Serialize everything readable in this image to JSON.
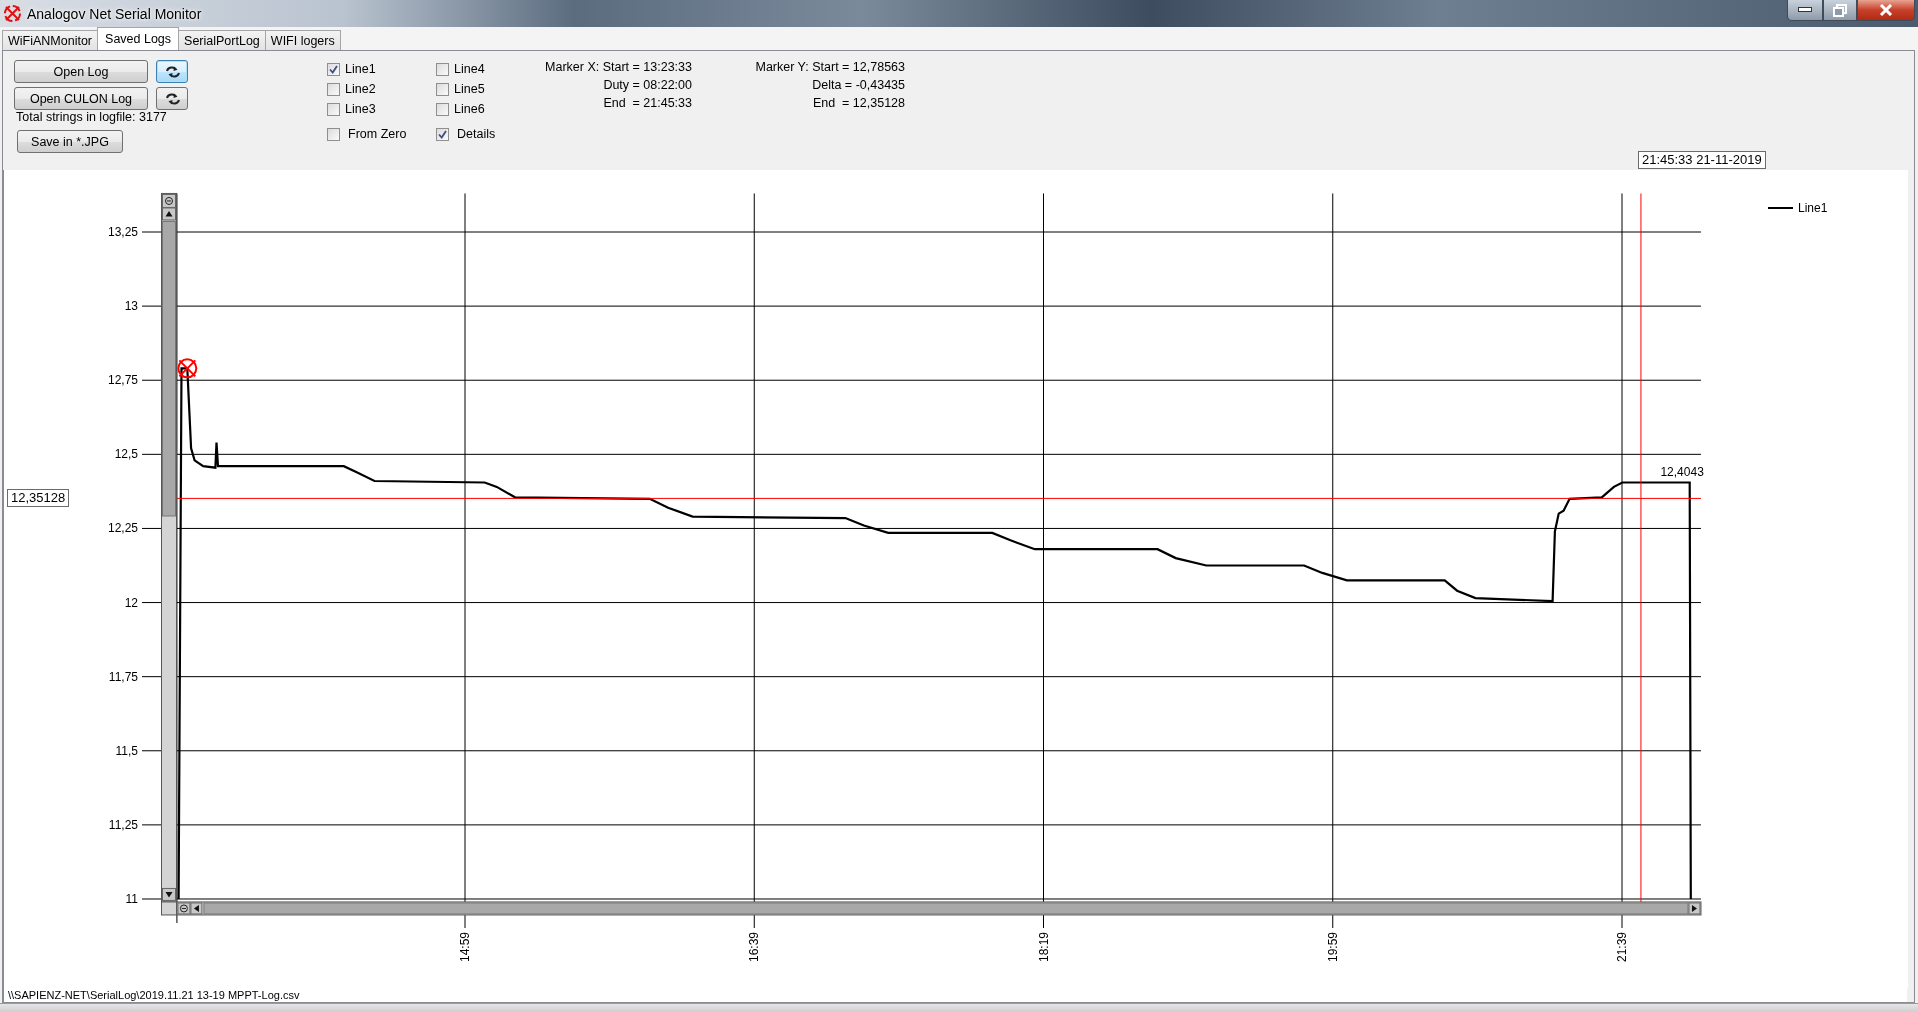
{
  "window": {
    "title": "Analogov Net Serial Monitor"
  },
  "tabs": [
    {
      "label": "WiFiANMonitor",
      "selected": false
    },
    {
      "label": "Saved Logs",
      "selected": true
    },
    {
      "label": "SerialPortLog",
      "selected": false
    },
    {
      "label": "WIFI logers",
      "selected": false
    }
  ],
  "log_controls": {
    "open_log": "Open Log",
    "open_culon_log": "Open CULON Log",
    "total_strings": "Total strings in logfile: 3177",
    "save_button": "Save in *.JPG",
    "refresh_buttons": [
      {
        "focused": true
      },
      {
        "focused": false
      }
    ]
  },
  "checkboxes": [
    {
      "label": "Line1",
      "checked": true
    },
    {
      "label": "Line2",
      "checked": false
    },
    {
      "label": "Line3",
      "checked": false
    },
    {
      "label": "From Zero",
      "checked": false
    },
    {
      "label": "Line4",
      "checked": false
    },
    {
      "label": "Line5",
      "checked": false
    },
    {
      "label": "Line6",
      "checked": false
    },
    {
      "label": "Details",
      "checked": true
    }
  ],
  "marker_x": [
    "Marker X: Start = 13:23:33",
    "Duty = 08:22:00",
    "End  = 21:45:33"
  ],
  "marker_y": [
    "Marker Y: Start = 12,78563",
    "Delta = -0,43435",
    "End  = 12,35128"
  ],
  "chart": {
    "chart_data": {
      "type": "line",
      "x": [
        800,
        801,
        803,
        804.3,
        805.5,
        808.5,
        812.7,
        813.1,
        813.6,
        857.1,
        861.4,
        867.7,
        905.8,
        910,
        916.3,
        962.9,
        969.2,
        977.7,
        1030.5,
        1036.9,
        1045.3,
        1081.3,
        1087.6,
        1096,
        1138.4,
        1144.7,
        1155.3,
        1189.1,
        1195.4,
        1203.9,
        1237.7,
        1242,
        1248.3,
        1275,
        1275.8,
        1277.1,
        1278.8,
        1280.9,
        1292,
        1296.2,
        1299.1,
        1322.4,
        1322.8
      ],
      "series": [
        {
          "name": "Line1",
          "color": "#000000",
          "values": [
            11,
            12.79,
            12.79,
            12.52,
            12.48,
            12.46,
            12.455,
            12.54,
            12.46,
            12.46,
            12.44,
            12.41,
            12.405,
            12.39,
            12.355,
            12.35,
            12.32,
            12.29,
            12.285,
            12.26,
            12.235,
            12.235,
            12.21,
            12.18,
            12.18,
            12.15,
            12.125,
            12.125,
            12.1,
            12.075,
            12.075,
            12.04,
            12.015,
            12.005,
            12.24,
            12.3,
            12.31,
            12.35,
            12.355,
            12.39,
            12.405,
            12.405,
            11
          ]
        }
      ],
      "xlim": [
        799.4,
        1326.3
      ],
      "ylim": [
        10.99,
        13.38
      ],
      "xticks": [
        {
          "value": 899,
          "label": "14:59"
        },
        {
          "value": 999,
          "label": "16:39"
        },
        {
          "value": 1099,
          "label": "18:19"
        },
        {
          "value": 1199,
          "label": "19:59"
        },
        {
          "value": 1299,
          "label": "21:39"
        }
      ],
      "yticks": [
        {
          "value": 13.25,
          "label": "13,25"
        },
        {
          "value": 13,
          "label": "13"
        },
        {
          "value": 12.75,
          "label": "12,75"
        },
        {
          "value": 12.5,
          "label": "12,5"
        },
        {
          "value": 12.25,
          "label": "12,25"
        },
        {
          "value": 12,
          "label": "12"
        },
        {
          "value": 11.75,
          "label": "11,75"
        },
        {
          "value": 11.5,
          "label": "11,5"
        },
        {
          "value": 11.25,
          "label": "11,25"
        },
        {
          "value": 11,
          "label": "11"
        }
      ],
      "grid": true,
      "ref_lines": [
        {
          "axis": "y",
          "value": 12.35128,
          "color": "#ff0000"
        },
        {
          "axis": "x",
          "value": 1305.55,
          "color": "#ff0000"
        }
      ],
      "annotations": [
        {
          "x": 1322.8,
          "y": 12.405,
          "text": "12,4043"
        }
      ]
    },
    "cursor_value": "12,35128",
    "cursor_time": "21:45:33 21-11-2019"
  },
  "status_path": "\\\\SAPIENZ-NET\\SerialLog\\2019.11.21 13-19 MPPT-Log.csv"
}
